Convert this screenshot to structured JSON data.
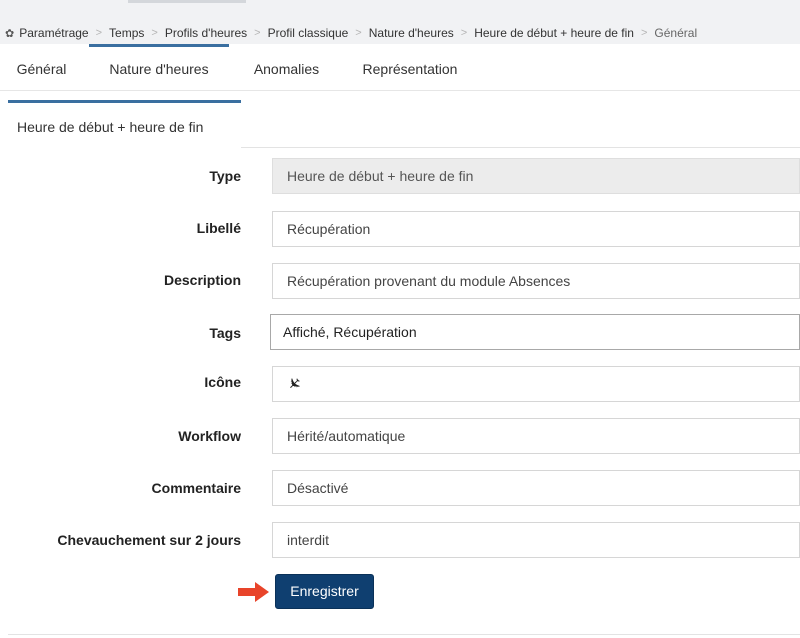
{
  "breadcrumb": {
    "icon": "gear-icon",
    "items": [
      "Paramétrage",
      "Temps",
      "Profils d'heures",
      "Profil classique",
      "Nature d'heures",
      "Heure de début + heure de fin",
      "Général"
    ]
  },
  "tabs": [
    {
      "label": "Général",
      "active": false
    },
    {
      "label": "Nature d'heures",
      "active": true
    },
    {
      "label": "Anomalies",
      "active": false
    },
    {
      "label": "Représentation",
      "active": false
    }
  ],
  "subtab": {
    "label": "Heure de début + heure de fin"
  },
  "form": {
    "type": {
      "label": "Type",
      "value": "Heure de début + heure de fin"
    },
    "libelle": {
      "label": "Libellé",
      "value": "Récupération"
    },
    "description": {
      "label": "Description",
      "value": "Récupération provenant du module Absences"
    },
    "tags": {
      "label": "Tags",
      "value": "Affiché, Récupération"
    },
    "icone": {
      "label": "Icône",
      "value": "✈",
      "icon": "plane-icon"
    },
    "workflow": {
      "label": "Workflow",
      "value": "Hérité/automatique"
    },
    "commentaire": {
      "label": "Commentaire",
      "value": "Désactivé"
    },
    "chevauchement": {
      "label": "Chevauchement sur 2 jours",
      "value": "interdit"
    }
  },
  "save_button": {
    "label": "Enregistrer"
  },
  "colors": {
    "accent": "#3a6fa0",
    "button": "#0f3f70",
    "arrow": "#e8442a"
  }
}
